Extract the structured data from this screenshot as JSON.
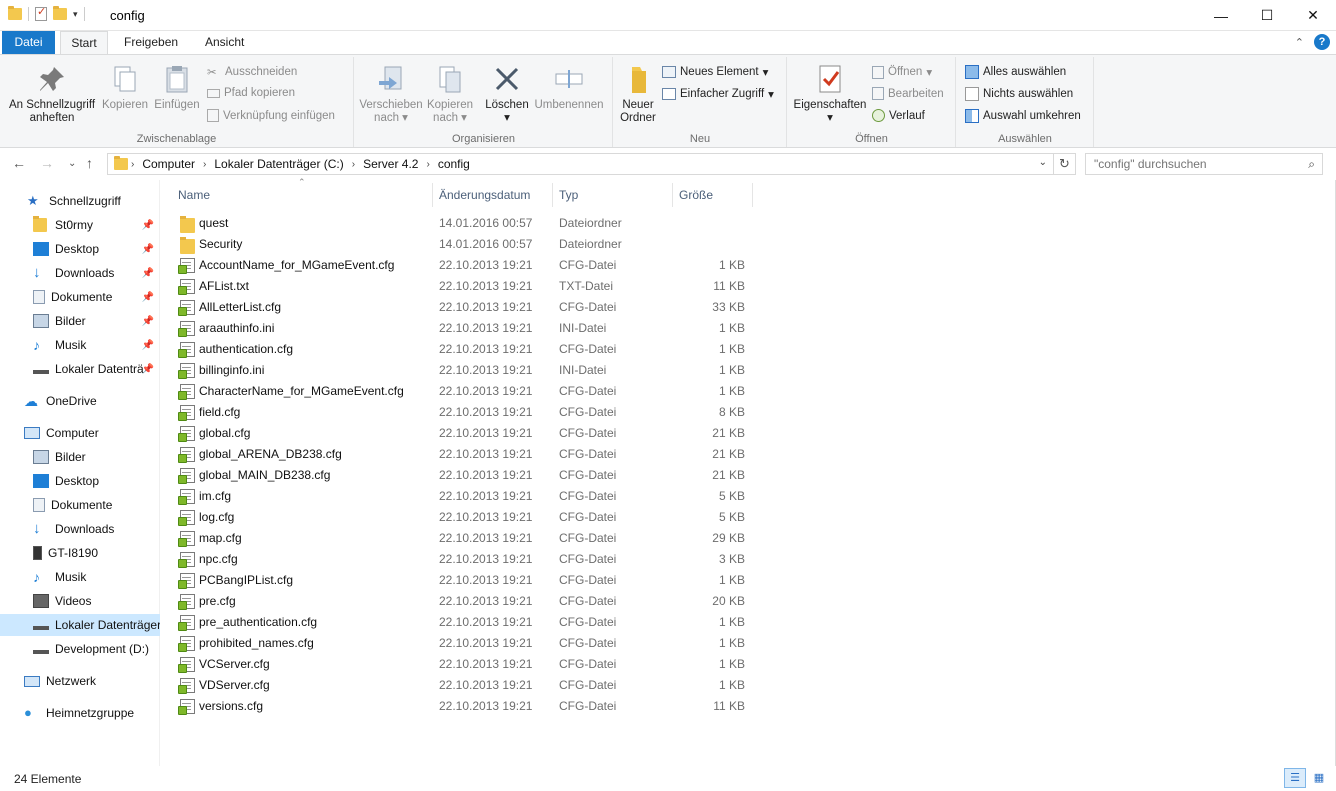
{
  "window": {
    "title": "config",
    "controls": {
      "minimize": "—",
      "maximize": "☐",
      "close": "✕"
    }
  },
  "tabs": {
    "file": "Datei",
    "start": "Start",
    "share": "Freigeben",
    "view": "Ansicht"
  },
  "ribbon": {
    "pin_quick_access": [
      "An Schnellzugriff",
      "anheften"
    ],
    "copy": "Kopieren",
    "paste": "Einfügen",
    "cut": "Ausschneiden",
    "copy_path": "Pfad kopieren",
    "paste_shortcut": "Verknüpfung einfügen",
    "group_clipboard": "Zwischenablage",
    "move_to": [
      "Verschieben",
      "nach"
    ],
    "copy_to": [
      "Kopieren",
      "nach"
    ],
    "delete": "Löschen",
    "rename": "Umbenennen",
    "group_organize": "Organisieren",
    "new_folder": [
      "Neuer",
      "Ordner"
    ],
    "new_item": "Neues Element",
    "easy_access": "Einfacher Zugriff",
    "group_new": "Neu",
    "properties": "Eigenschaften",
    "open": "Öffnen",
    "edit": "Bearbeiten",
    "history": "Verlauf",
    "group_open": "Öffnen",
    "select_all": "Alles auswählen",
    "select_none": "Nichts auswählen",
    "invert_selection": "Auswahl umkehren",
    "group_select": "Auswählen"
  },
  "address": {
    "crumbs": [
      "Computer",
      "Lokaler Datenträger (C:)",
      "Server 4.2",
      "config"
    ],
    "search_placeholder": "\"config\" durchsuchen"
  },
  "nav": {
    "quick_access": "Schnellzugriff",
    "quick_items": [
      "St0rmy",
      "Desktop",
      "Downloads",
      "Dokumente",
      "Bilder",
      "Musik",
      "Lokaler Datenträ"
    ],
    "onedrive": "OneDrive",
    "computer": "Computer",
    "computer_items": [
      "Bilder",
      "Desktop",
      "Dokumente",
      "Downloads",
      "GT-I8190",
      "Musik",
      "Videos",
      "Lokaler Datenträger",
      "Development (D:)"
    ],
    "network": "Netzwerk",
    "homegroup": "Heimnetzgruppe"
  },
  "columns": {
    "name": "Name",
    "date": "Änderungsdatum",
    "type": "Typ",
    "size": "Größe"
  },
  "files": [
    {
      "name": "quest",
      "date": "14.01.2016 00:57",
      "type": "Dateiordner",
      "size": "",
      "icon": "folder"
    },
    {
      "name": "Security",
      "date": "14.01.2016 00:57",
      "type": "Dateiordner",
      "size": "",
      "icon": "folder"
    },
    {
      "name": "AccountName_for_MGameEvent.cfg",
      "date": "22.10.2013 19:21",
      "type": "CFG-Datei",
      "size": "1 KB",
      "icon": "cfg"
    },
    {
      "name": "AFList.txt",
      "date": "22.10.2013 19:21",
      "type": "TXT-Datei",
      "size": "11 KB",
      "icon": "cfg"
    },
    {
      "name": "AllLetterList.cfg",
      "date": "22.10.2013 19:21",
      "type": "CFG-Datei",
      "size": "33 KB",
      "icon": "cfg"
    },
    {
      "name": "araauthinfo.ini",
      "date": "22.10.2013 19:21",
      "type": "INI-Datei",
      "size": "1 KB",
      "icon": "cfg"
    },
    {
      "name": "authentication.cfg",
      "date": "22.10.2013 19:21",
      "type": "CFG-Datei",
      "size": "1 KB",
      "icon": "cfg"
    },
    {
      "name": "billinginfo.ini",
      "date": "22.10.2013 19:21",
      "type": "INI-Datei",
      "size": "1 KB",
      "icon": "cfg"
    },
    {
      "name": "CharacterName_for_MGameEvent.cfg",
      "date": "22.10.2013 19:21",
      "type": "CFG-Datei",
      "size": "1 KB",
      "icon": "cfg"
    },
    {
      "name": "field.cfg",
      "date": "22.10.2013 19:21",
      "type": "CFG-Datei",
      "size": "8 KB",
      "icon": "cfg"
    },
    {
      "name": "global.cfg",
      "date": "22.10.2013 19:21",
      "type": "CFG-Datei",
      "size": "21 KB",
      "icon": "cfg"
    },
    {
      "name": "global_ARENA_DB238.cfg",
      "date": "22.10.2013 19:21",
      "type": "CFG-Datei",
      "size": "21 KB",
      "icon": "cfg"
    },
    {
      "name": "global_MAIN_DB238.cfg",
      "date": "22.10.2013 19:21",
      "type": "CFG-Datei",
      "size": "21 KB",
      "icon": "cfg"
    },
    {
      "name": "im.cfg",
      "date": "22.10.2013 19:21",
      "type": "CFG-Datei",
      "size": "5 KB",
      "icon": "cfg"
    },
    {
      "name": "log.cfg",
      "date": "22.10.2013 19:21",
      "type": "CFG-Datei",
      "size": "5 KB",
      "icon": "cfg"
    },
    {
      "name": "map.cfg",
      "date": "22.10.2013 19:21",
      "type": "CFG-Datei",
      "size": "29 KB",
      "icon": "cfg"
    },
    {
      "name": "npc.cfg",
      "date": "22.10.2013 19:21",
      "type": "CFG-Datei",
      "size": "3 KB",
      "icon": "cfg"
    },
    {
      "name": "PCBangIPList.cfg",
      "date": "22.10.2013 19:21",
      "type": "CFG-Datei",
      "size": "1 KB",
      "icon": "cfg"
    },
    {
      "name": "pre.cfg",
      "date": "22.10.2013 19:21",
      "type": "CFG-Datei",
      "size": "20 KB",
      "icon": "cfg"
    },
    {
      "name": "pre_authentication.cfg",
      "date": "22.10.2013 19:21",
      "type": "CFG-Datei",
      "size": "1 KB",
      "icon": "cfg"
    },
    {
      "name": "prohibited_names.cfg",
      "date": "22.10.2013 19:21",
      "type": "CFG-Datei",
      "size": "1 KB",
      "icon": "cfg"
    },
    {
      "name": "VCServer.cfg",
      "date": "22.10.2013 19:21",
      "type": "CFG-Datei",
      "size": "1 KB",
      "icon": "cfg"
    },
    {
      "name": "VDServer.cfg",
      "date": "22.10.2013 19:21",
      "type": "CFG-Datei",
      "size": "1 KB",
      "icon": "cfg"
    },
    {
      "name": "versions.cfg",
      "date": "22.10.2013 19:21",
      "type": "CFG-Datei",
      "size": "11 KB",
      "icon": "cfg"
    }
  ],
  "status": {
    "count": "24 Elemente"
  },
  "colors": {
    "accent": "#1979ca",
    "selection": "#cce8ff",
    "folder": "#f3c84e"
  }
}
